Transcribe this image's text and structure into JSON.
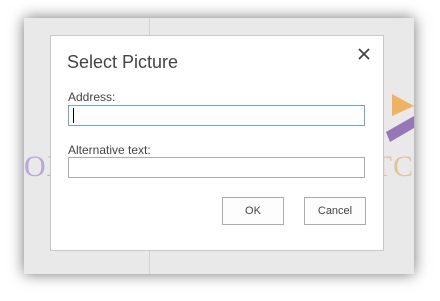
{
  "background": {
    "left_text": "OX",
    "right_text": "TC",
    "accent_colors": {
      "purple": "#7b4fa8",
      "orange": "#f0a030"
    }
  },
  "dialog": {
    "title": "Select Picture",
    "close_icon": "close-icon",
    "address": {
      "label": "Address:",
      "value": "",
      "placeholder": ""
    },
    "alt_text": {
      "label": "Alternative text:",
      "value": "",
      "placeholder": ""
    },
    "buttons": {
      "ok_label": "OK",
      "cancel_label": "Cancel"
    }
  }
}
